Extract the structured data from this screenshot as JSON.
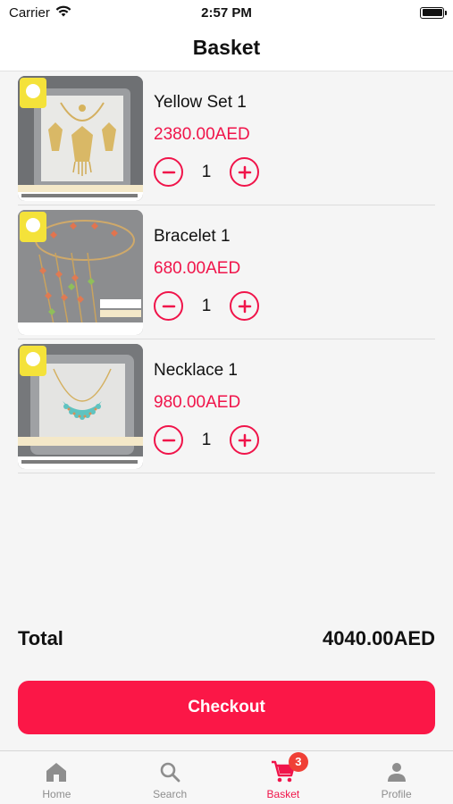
{
  "status_bar": {
    "carrier": "Carrier",
    "time": "2:57 PM",
    "icons": [
      "wifi-icon",
      "battery-icon"
    ]
  },
  "header": {
    "title": "Basket"
  },
  "basket": {
    "items": [
      {
        "name": "Yellow Set 1",
        "price": "2380.00AED",
        "quantity": "1",
        "thumbnail_icon": "jewelry-set-photo"
      },
      {
        "name": "Bracelet 1",
        "price": "680.00AED",
        "quantity": "1",
        "thumbnail_icon": "bracelet-photo"
      },
      {
        "name": "Necklace 1",
        "price": "980.00AED",
        "quantity": "1",
        "thumbnail_icon": "necklace-photo"
      }
    ]
  },
  "summary": {
    "total_label": "Total",
    "total_value": "4040.00AED"
  },
  "checkout": {
    "label": "Checkout"
  },
  "tab_bar": {
    "tabs": [
      {
        "label": "Home",
        "icon": "home-icon",
        "active": false
      },
      {
        "label": "Search",
        "icon": "search-icon",
        "active": false
      },
      {
        "label": "Basket",
        "icon": "cart-icon",
        "active": true,
        "badge": "3"
      },
      {
        "label": "Profile",
        "icon": "person-icon",
        "active": false
      }
    ]
  },
  "colors": {
    "accent": "#f0144a",
    "checkout_bg": "#fb1747",
    "badge_bg": "#f04036",
    "inactive_tab": "#8e8e8e"
  }
}
